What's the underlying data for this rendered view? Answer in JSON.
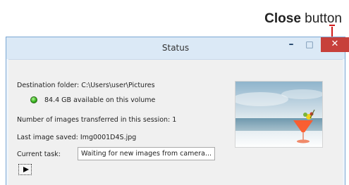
{
  "callout": {
    "bold": "Close",
    "rest": " button",
    "line_color": "#d11a1a"
  },
  "window": {
    "title": "Status",
    "minimize_glyph": "–",
    "maximize_glyph": "□",
    "close_glyph": "✕",
    "close_color": "#c7403b"
  },
  "destination": {
    "label": "Destination folder:",
    "value": "C:\\Users\\user\\Pictures"
  },
  "volume": {
    "size": "84.4 GB",
    "text": "available on this volume",
    "status_color": "#37b51e"
  },
  "transferred": {
    "label": "Number of images transferred in this session:",
    "value": "1"
  },
  "last_saved": {
    "label": "Last image saved:",
    "value": "Img0001D4S.jpg"
  },
  "current_task": {
    "label": "Current task:",
    "value": "Waiting for new images from camera..."
  },
  "icons": {
    "play": "play-icon",
    "status": "status-light-icon"
  }
}
